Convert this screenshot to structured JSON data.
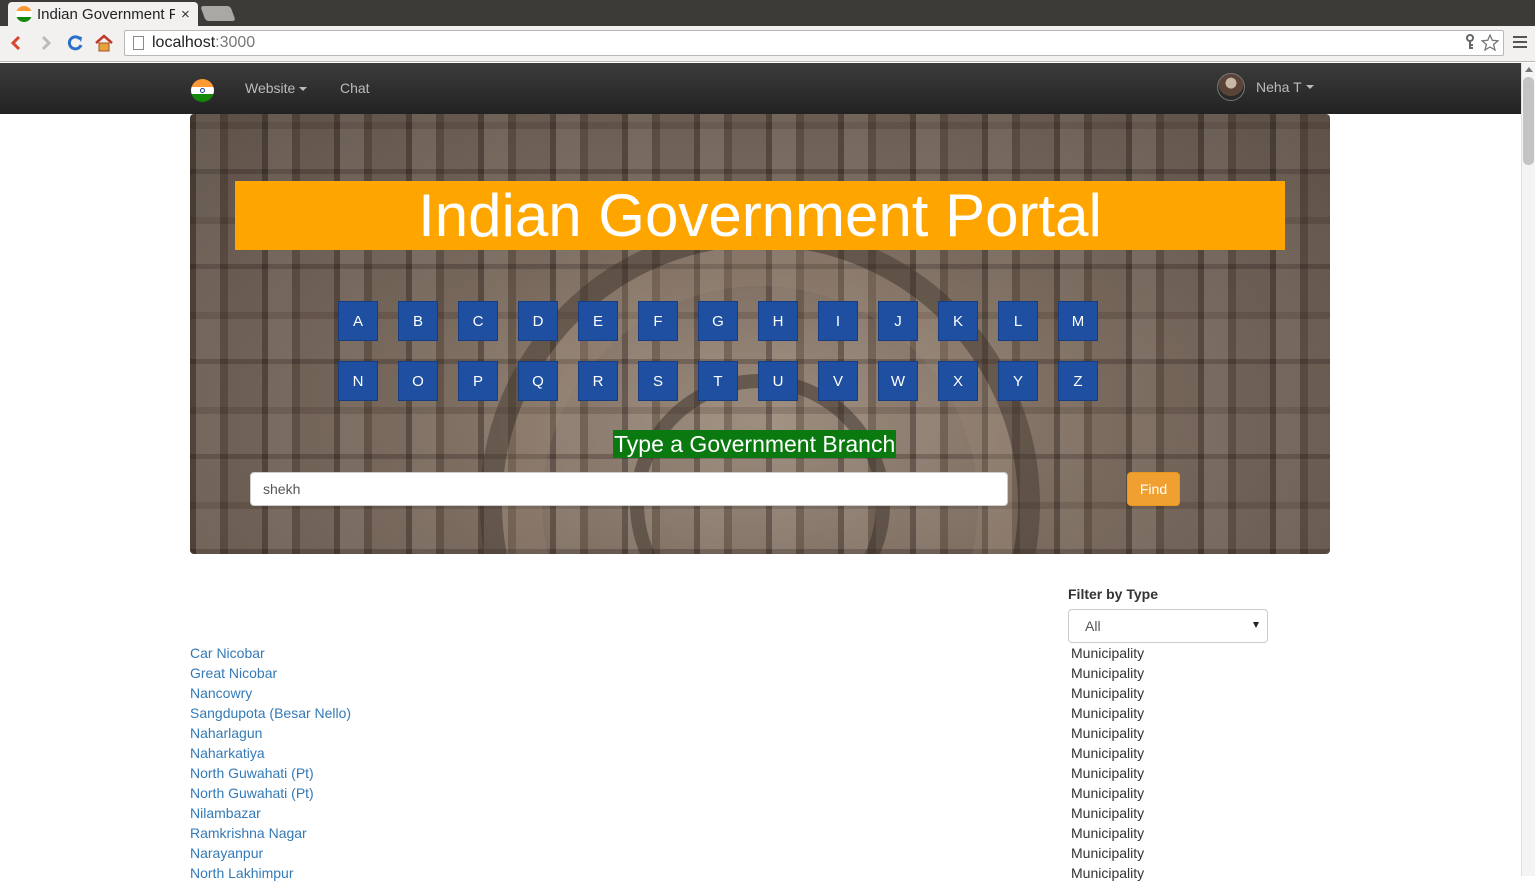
{
  "browser": {
    "tab_title": "Indian Government Portal",
    "tab_close": "×",
    "url_host": "localhost",
    "url_port": ":3000",
    "icons": [
      "back-icon",
      "forward-icon",
      "reload-icon",
      "home-icon",
      "page-icon",
      "key-icon",
      "star-icon",
      "menu-icon"
    ]
  },
  "navbar": {
    "website_label": "Website",
    "chat_label": "Chat",
    "user_name": "Neha T"
  },
  "hero": {
    "title": "Indian Government Portal",
    "letters_row1": [
      "A",
      "B",
      "C",
      "D",
      "E",
      "F",
      "G",
      "H",
      "I",
      "J",
      "K",
      "L",
      "M"
    ],
    "letters_row2": [
      "N",
      "O",
      "P",
      "Q",
      "R",
      "S",
      "T",
      "U",
      "V",
      "W",
      "X",
      "Y",
      "Z"
    ],
    "prompt": "Type a Government Branch",
    "search_value": "shekh",
    "find_label": "Find"
  },
  "filter": {
    "label": "Filter by Type",
    "selected": "All"
  },
  "results": [
    {
      "name": "Car Nicobar",
      "type": "Municipality"
    },
    {
      "name": "Great Nicobar",
      "type": "Municipality"
    },
    {
      "name": "Nancowry",
      "type": "Municipality"
    },
    {
      "name": "Sangdupota (Besar Nello)",
      "type": "Municipality"
    },
    {
      "name": "Naharlagun",
      "type": "Municipality"
    },
    {
      "name": "Naharkatiya",
      "type": "Municipality"
    },
    {
      "name": "North Guwahati (Pt)",
      "type": "Municipality"
    },
    {
      "name": "North Guwahati (Pt)",
      "type": "Municipality"
    },
    {
      "name": "Nilambazar",
      "type": "Municipality"
    },
    {
      "name": "Ramkrishna Nagar",
      "type": "Municipality"
    },
    {
      "name": "Narayanpur",
      "type": "Municipality"
    },
    {
      "name": "North Lakhimpur",
      "type": "Municipality"
    }
  ],
  "colors": {
    "saffron": "#ffa500",
    "letter_button": "#1e4fa0",
    "prompt_bg": "#0a7a10",
    "find_button": "#f0a030",
    "link": "#337ab7"
  }
}
